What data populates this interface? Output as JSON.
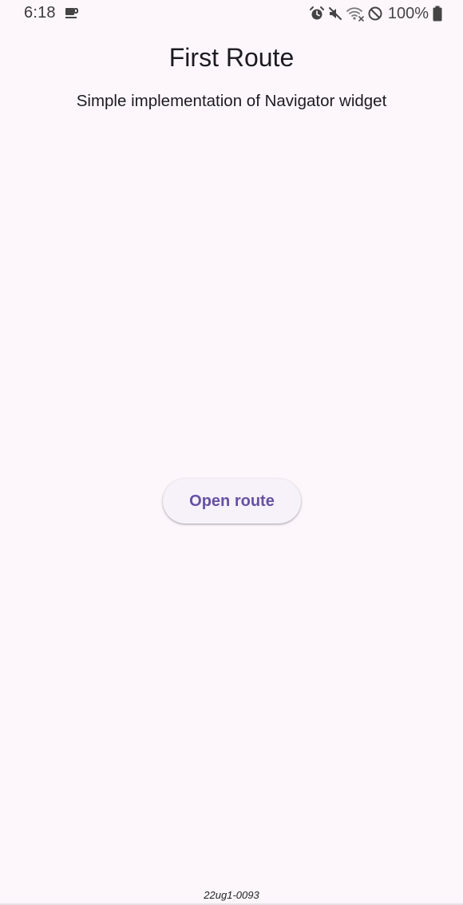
{
  "status_bar": {
    "time": "6:18",
    "left_icon": "coffee-cup-icon",
    "right_icons": [
      "alarm-icon",
      "mute-icon",
      "wifi-icon",
      "do-not-disturb-icon"
    ],
    "battery_text": "100%",
    "battery_icon": "battery-full-icon"
  },
  "page": {
    "title": "First Route",
    "subtitle": "Simple implementation of Navigator widget",
    "button_label": "Open route",
    "footer_id": "22ug1-0093"
  },
  "colors": {
    "background": "#FDF7FC",
    "button_background": "#F7F2FA",
    "button_text": "#6750A4",
    "text": "#1D1B20"
  }
}
